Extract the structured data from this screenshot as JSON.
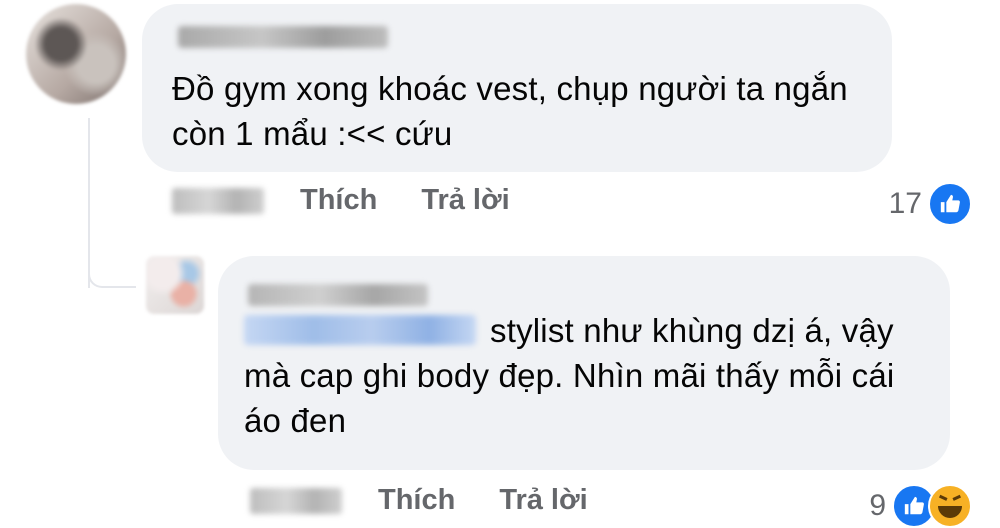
{
  "comment": {
    "text": "Đồ gym xong khoác vest, chụp người ta ngắn còn 1 mẩu :<< cứu",
    "actions": {
      "like_label": "Thích",
      "reply_label": "Trả lời"
    },
    "reaction_count": "17",
    "reaction_icons": [
      "like-icon"
    ]
  },
  "reply": {
    "text": "stylist như khùng dzị á, vậy mà cap ghi body đẹp. Nhìn mãi thấy mỗi cái áo đen",
    "actions": {
      "like_label": "Thích",
      "reply_label": "Trả lời"
    },
    "reaction_count": "9",
    "reaction_icons": [
      "like-icon",
      "haha-icon"
    ]
  },
  "colors": {
    "bubble": "#f0f2f5",
    "text": "#050505",
    "secondary_text": "#65676b",
    "like_blue": "#1877f2",
    "haha_yellow": "#f7b125"
  }
}
